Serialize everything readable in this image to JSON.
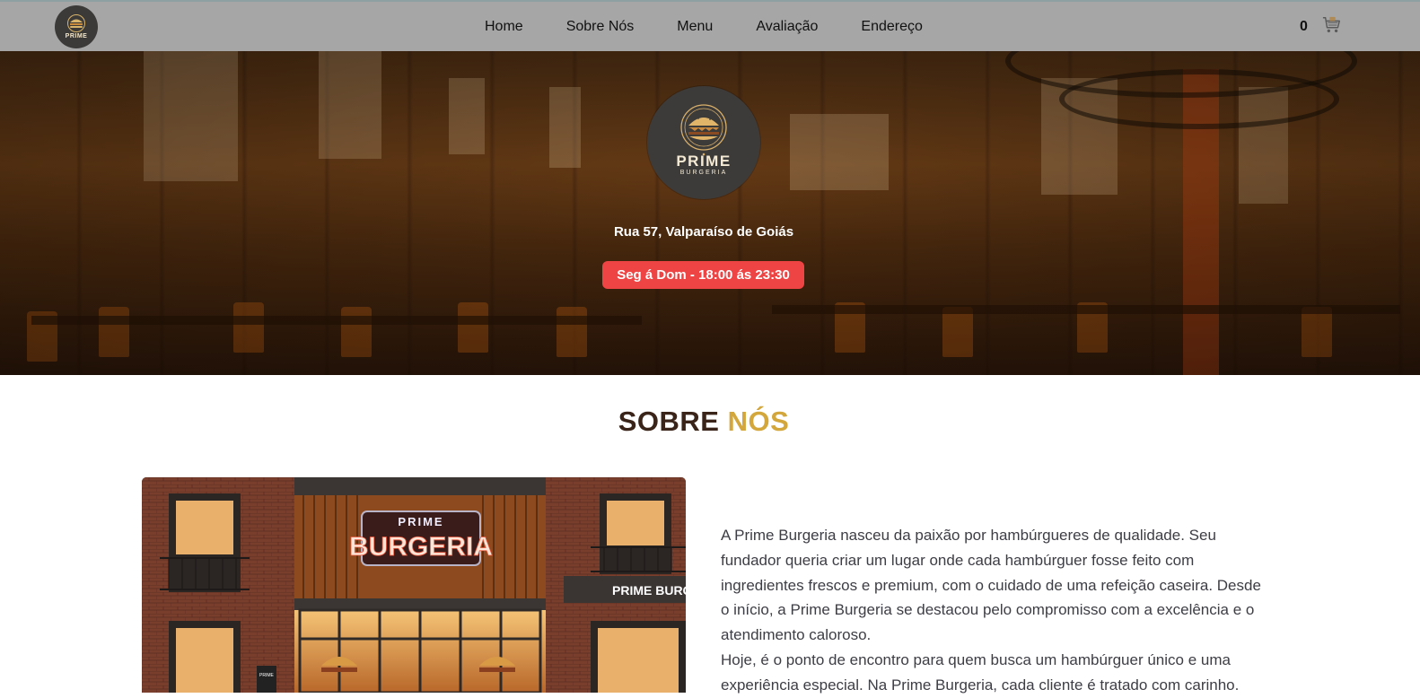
{
  "nav": {
    "logo_text": "PRIME",
    "links": [
      "Home",
      "Sobre Nós",
      "Menu",
      "Avaliação",
      "Endereço"
    ],
    "cart_count": "0",
    "cart_icon": "cart-icon"
  },
  "hero": {
    "logo_title": "PRIME",
    "logo_subtitle": "BURGERIA",
    "address": "Rua 57, Valparaíso de Goiás",
    "hours": "Seg á Dom - 18:00 ás 23:30"
  },
  "about": {
    "title_part1": "SOBRE",
    "title_part2": "NÓS",
    "store_sign_top": "PRIME",
    "store_sign_main": "BURGERIA",
    "store_side_sign": "PRIME BURGERI",
    "store_small_sign": "PRIME",
    "paragraph1": "A Prime Burgeria nasceu da paixão por hambúrgueres de qualidade. Seu fundador queria criar um lugar onde cada hambúrguer fosse feito com ingredientes frescos e premium, com o cuidado de uma refeição caseira. Desde o início, a Prime Burgeria se destacou pelo compromisso com a excelência e o atendimento caloroso.",
    "paragraph2": "Hoje, é o ponto de encontro para quem busca um hambúrguer único e uma experiência especial. Na Prime Burgeria, cada cliente é tratado com carinho."
  },
  "colors": {
    "navbar": "#a6a6a6",
    "hours_badge": "#ef4444",
    "title_dark": "#3a2419",
    "title_gold": "#d3a73c"
  }
}
